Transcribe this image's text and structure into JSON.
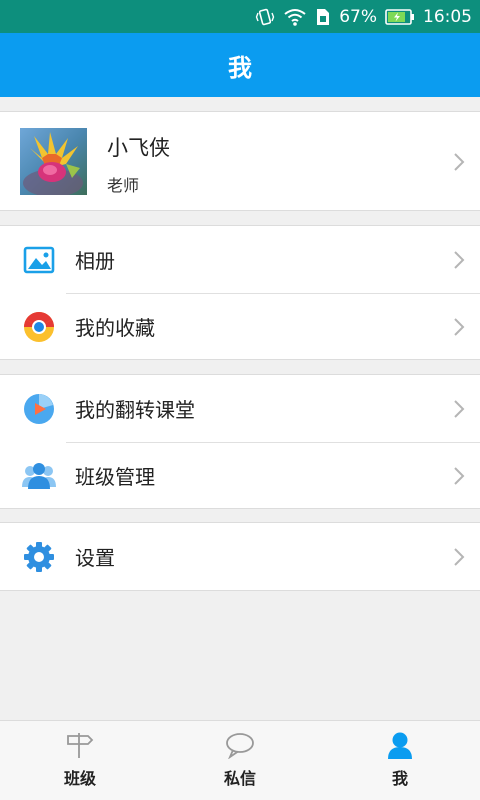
{
  "status_bar": {
    "battery_percent": "67%",
    "time": "16:05",
    "icons": [
      "vibrate-icon",
      "wifi-icon",
      "sim-icon",
      "battery-icon"
    ]
  },
  "header": {
    "title": "我"
  },
  "profile": {
    "name": "小飞侠",
    "role": "老师",
    "avatar": "avatar-photo"
  },
  "menu": {
    "album": {
      "label": "相册",
      "icon": "album-icon",
      "color": "#1aa0e8"
    },
    "favorites": {
      "label": "我的收藏",
      "icon": "favorites-icon",
      "color": "#e53935"
    },
    "flipped_class": {
      "label": "我的翻转课堂",
      "icon": "flipped-class-icon",
      "color": "#4aa8ef"
    },
    "class_manage": {
      "label": "班级管理",
      "icon": "class-manage-icon",
      "color": "#4aa8ef"
    },
    "settings": {
      "label": "设置",
      "icon": "settings-icon",
      "color": "#2f8fe0"
    }
  },
  "tabbar": {
    "tabs": [
      {
        "label": "班级",
        "icon": "signpost-icon"
      },
      {
        "label": "私信",
        "icon": "chat-bubble-icon"
      },
      {
        "label": "我",
        "icon": "person-icon"
      }
    ],
    "active_index": 2,
    "active_color": "#0b9cf0"
  },
  "colors": {
    "status_bar": "#0d8f7d",
    "header": "#0b9cf0",
    "background": "#f0f0f0"
  }
}
